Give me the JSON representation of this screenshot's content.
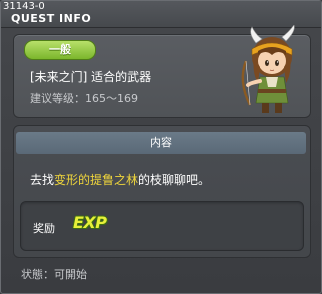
{
  "window": {
    "quest_id": "31143-0",
    "title": "QUEST INFO"
  },
  "quest": {
    "category_badge": "一般",
    "name": "[未来之门] 适合的武器",
    "level_label": "建议等级：",
    "level_range": "165～169"
  },
  "content": {
    "header": "内容",
    "task_prefix": "去找",
    "task_highlight": "变形的提鲁之林",
    "task_suffix": "的枝聊聊吧。"
  },
  "reward": {
    "label": "奖励",
    "exp_text": "EXP"
  },
  "status": {
    "label": "状態：",
    "value": "可開始"
  },
  "colors": {
    "badge_green": "#7bb62c",
    "highlight_yellow": "#f0d63c",
    "header_blue": "#5a6977"
  },
  "icons": {
    "portrait": "npc-portrait-icon",
    "exp": "exp-icon"
  }
}
